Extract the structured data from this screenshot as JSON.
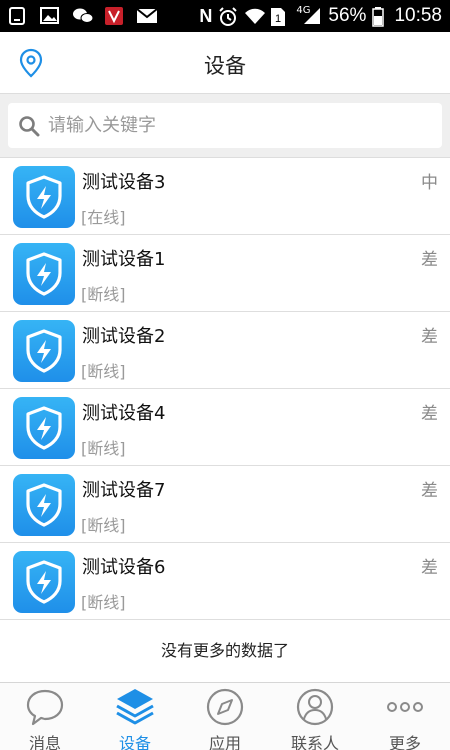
{
  "status_bar": {
    "battery_percent": "56%",
    "time": "10:58",
    "network_type": "4G"
  },
  "header": {
    "title": "设备",
    "location_icon": "location-pin-icon"
  },
  "search": {
    "placeholder": "请输入关键字",
    "icon": "search-icon"
  },
  "devices": [
    {
      "name": "测试设备3",
      "status": "[在线]",
      "signal": "中"
    },
    {
      "name": "测试设备1",
      "status": "[断线]",
      "signal": "差"
    },
    {
      "name": "测试设备2",
      "status": "[断线]",
      "signal": "差"
    },
    {
      "name": "测试设备4",
      "status": "[断线]",
      "signal": "差"
    },
    {
      "name": "测试设备7",
      "status": "[断线]",
      "signal": "差"
    },
    {
      "name": "测试设备6",
      "status": "[断线]",
      "signal": "差"
    }
  ],
  "list_footer": "没有更多的数据了",
  "tabs": [
    {
      "label": "消息",
      "icon": "message-bubble-icon",
      "active": false
    },
    {
      "label": "设备",
      "icon": "layers-icon",
      "active": true
    },
    {
      "label": "应用",
      "icon": "compass-icon",
      "active": false
    },
    {
      "label": "联系人",
      "icon": "contact-person-icon",
      "active": false
    },
    {
      "label": "更多",
      "icon": "more-dots-icon",
      "active": false
    }
  ],
  "colors": {
    "accent": "#1e8fe6",
    "icon_gradient_top": "#36b4f5",
    "icon_gradient_bottom": "#1f8fe9",
    "status_bar": "#000000"
  }
}
